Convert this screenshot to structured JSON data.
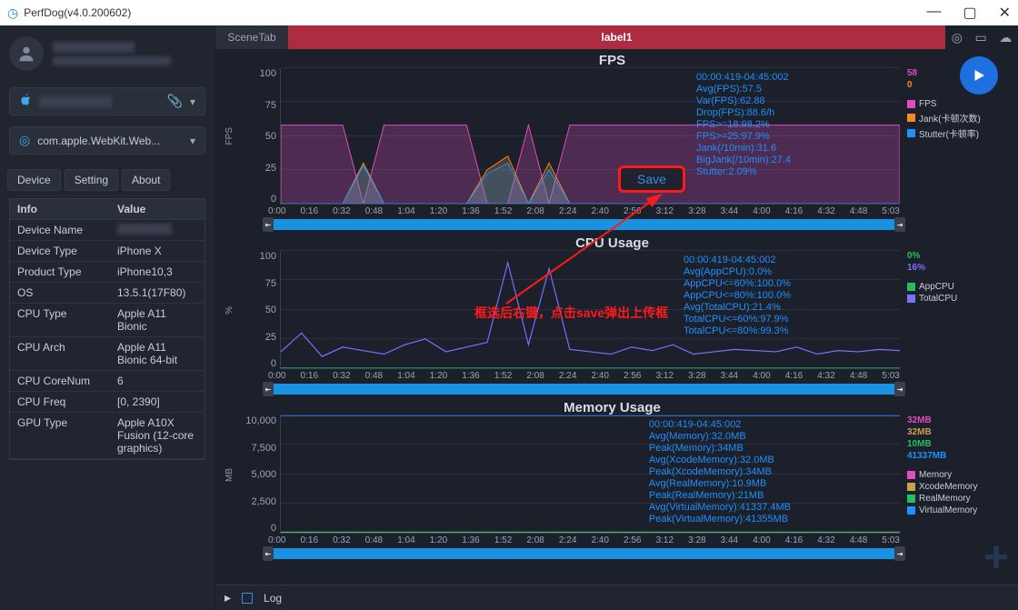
{
  "window_title": "PerfDog(v4.0.200602)",
  "topbar": {
    "scenetab": "SceneTab",
    "label": "label1"
  },
  "device_selector": {
    "label": ""
  },
  "app_selector": {
    "label": "com.apple.WebKit.Web..."
  },
  "tabs": {
    "device": "Device",
    "setting": "Setting",
    "about": "About"
  },
  "info_table": {
    "header_info": "Info",
    "header_value": "Value",
    "rows": [
      {
        "k": "Device Name",
        "v": ""
      },
      {
        "k": "Device Type",
        "v": "iPhone X"
      },
      {
        "k": "Product Type",
        "v": "iPhone10,3"
      },
      {
        "k": "OS",
        "v": "13.5.1(17F80)"
      },
      {
        "k": "CPU Type",
        "v": "Apple A11 Bionic"
      },
      {
        "k": "CPU Arch",
        "v": "Apple A11 Bionic 64-bit"
      },
      {
        "k": "CPU CoreNum",
        "v": "6"
      },
      {
        "k": "CPU Freq",
        "v": "[0, 2390]"
      },
      {
        "k": "GPU Type",
        "v": "Apple A10X Fusion (12-core graphics)"
      }
    ]
  },
  "chart_data": [
    {
      "type": "area",
      "title": "FPS",
      "ylabel": "FPS",
      "ylim": [
        0,
        100
      ],
      "yticks": [
        0,
        25,
        50,
        75,
        100
      ],
      "x_categories": [
        "0:00",
        "0:16",
        "0:32",
        "0:48",
        "1:04",
        "1:20",
        "1:36",
        "1:52",
        "2:08",
        "2:24",
        "2:40",
        "2:56",
        "3:12",
        "3:28",
        "3:44",
        "4:00",
        "4:16",
        "4:32",
        "4:48",
        "5:03"
      ],
      "series": [
        {
          "name": "FPS",
          "color": "#e24bc4",
          "baseline": 58,
          "values": [
            58,
            58,
            58,
            58,
            0,
            58,
            58,
            58,
            58,
            58,
            0,
            0,
            58,
            0,
            58,
            58,
            58,
            58,
            58,
            58,
            58,
            58,
            58,
            58,
            58,
            58,
            58,
            58,
            58,
            58,
            58
          ]
        },
        {
          "name": "Jank(卡顿次数)",
          "color": "#f58a1f",
          "baseline": 0,
          "values": [
            0,
            0,
            0,
            0,
            30,
            0,
            0,
            0,
            0,
            0,
            25,
            35,
            0,
            30,
            0,
            0,
            0,
            0,
            0,
            0,
            0,
            0,
            0,
            0,
            0,
            0,
            0,
            0,
            0,
            0,
            0
          ]
        },
        {
          "name": "Stutter(卡顿率)",
          "color": "#1e90ff",
          "baseline": 0,
          "values": [
            0,
            0,
            0,
            0,
            28,
            0,
            0,
            0,
            0,
            0,
            22,
            30,
            0,
            25,
            0,
            0,
            0,
            0,
            0,
            0,
            0,
            0,
            0,
            0,
            0,
            0,
            0,
            0,
            0,
            0,
            0
          ]
        }
      ],
      "current_values": [
        {
          "v": "58",
          "c": "#e24bc4"
        },
        {
          "v": "0",
          "c": "#f58a1f"
        }
      ],
      "stats": [
        "00:00:419-04:45:002",
        "Avg(FPS):57.5",
        "Var(FPS):62.88",
        "Drop(FPS):88.6/h",
        "FPS>=18:98.2%",
        "FPS>=25:97.9%",
        "Jank(/10min):31.6",
        "BigJank(/10min):27.4",
        "Stutter:2.09%"
      ]
    },
    {
      "type": "line",
      "title": "CPU Usage",
      "ylabel": "%",
      "ylim": [
        0,
        100
      ],
      "yticks": [
        0,
        25,
        50,
        75,
        100
      ],
      "x_categories": [
        "0:00",
        "0:16",
        "0:32",
        "0:48",
        "1:04",
        "1:20",
        "1:36",
        "1:52",
        "2:08",
        "2:24",
        "2:40",
        "2:56",
        "3:12",
        "3:28",
        "3:44",
        "4:00",
        "4:16",
        "4:32",
        "4:48",
        "5:03"
      ],
      "series": [
        {
          "name": "AppCPU",
          "color": "#22c05e",
          "baseline": 0,
          "values": [
            0,
            0,
            0,
            0,
            0,
            0,
            0,
            0,
            0,
            0,
            0,
            0,
            0,
            0,
            0,
            0,
            0,
            0,
            0,
            0,
            0,
            0,
            0,
            0,
            0,
            0,
            0,
            0,
            0,
            0,
            0
          ]
        },
        {
          "name": "TotalCPU",
          "color": "#7a6fff",
          "baseline": 16,
          "values": [
            14,
            30,
            10,
            18,
            15,
            12,
            20,
            25,
            14,
            18,
            22,
            90,
            20,
            85,
            16,
            14,
            12,
            18,
            15,
            20,
            12,
            14,
            16,
            15,
            14,
            18,
            12,
            15,
            14,
            16,
            15
          ]
        }
      ],
      "current_values": [
        {
          "v": "0%",
          "c": "#22c05e"
        },
        {
          "v": "16%",
          "c": "#7a6fff"
        }
      ],
      "stats": [
        "00:00:419-04:45:002",
        "Avg(AppCPU):0.0%",
        "AppCPU<=60%:100.0%",
        "AppCPU<=80%:100.0%",
        "Avg(TotalCPU):21.4%",
        "TotalCPU<=60%:97.9%",
        "TotalCPU<=80%:99.3%"
      ]
    },
    {
      "type": "line",
      "title": "Memory Usage",
      "ylabel": "MB",
      "ylim": [
        0,
        10000
      ],
      "yticks": [
        0,
        2500,
        5000,
        7500,
        10000
      ],
      "x_categories": [
        "0:00",
        "0:16",
        "0:32",
        "0:48",
        "1:04",
        "1:20",
        "1:36",
        "1:52",
        "2:08",
        "2:24",
        "2:40",
        "2:56",
        "3:12",
        "3:28",
        "3:44",
        "4:00",
        "4:16",
        "4:32",
        "4:48",
        "5:03"
      ],
      "series": [
        {
          "name": "Memory",
          "color": "#e24bc4",
          "baseline": 32
        },
        {
          "name": "XcodeMemory",
          "color": "#c9a24a",
          "baseline": 32
        },
        {
          "name": "RealMemory",
          "color": "#22c05e",
          "baseline": 10
        },
        {
          "name": "VirtualMemory",
          "color": "#1e90ff",
          "baseline": 41337
        }
      ],
      "current_values": [
        {
          "v": "32MB",
          "c": "#e24bc4"
        },
        {
          "v": "32MB",
          "c": "#c9a24a"
        },
        {
          "v": "10MB",
          "c": "#22c05e"
        },
        {
          "v": "41337MB",
          "c": "#1e90ff"
        }
      ],
      "stats": [
        "00:00:419-04:45:002",
        "Avg(Memory):32.0MB",
        "Peak(Memory):34MB",
        "Avg(XcodeMemory):32.0MB",
        "Peak(XcodeMemory):34MB",
        "Avg(RealMemory):10.9MB",
        "Peak(RealMemory):21MB",
        "Avg(VirtualMemory):41337.4MB",
        "Peak(VirtualMemory):41355MB"
      ]
    }
  ],
  "save_btn": "Save",
  "annotation_text": "框选后右键，点击save弹出上传框",
  "bottom": {
    "log": "Log"
  }
}
